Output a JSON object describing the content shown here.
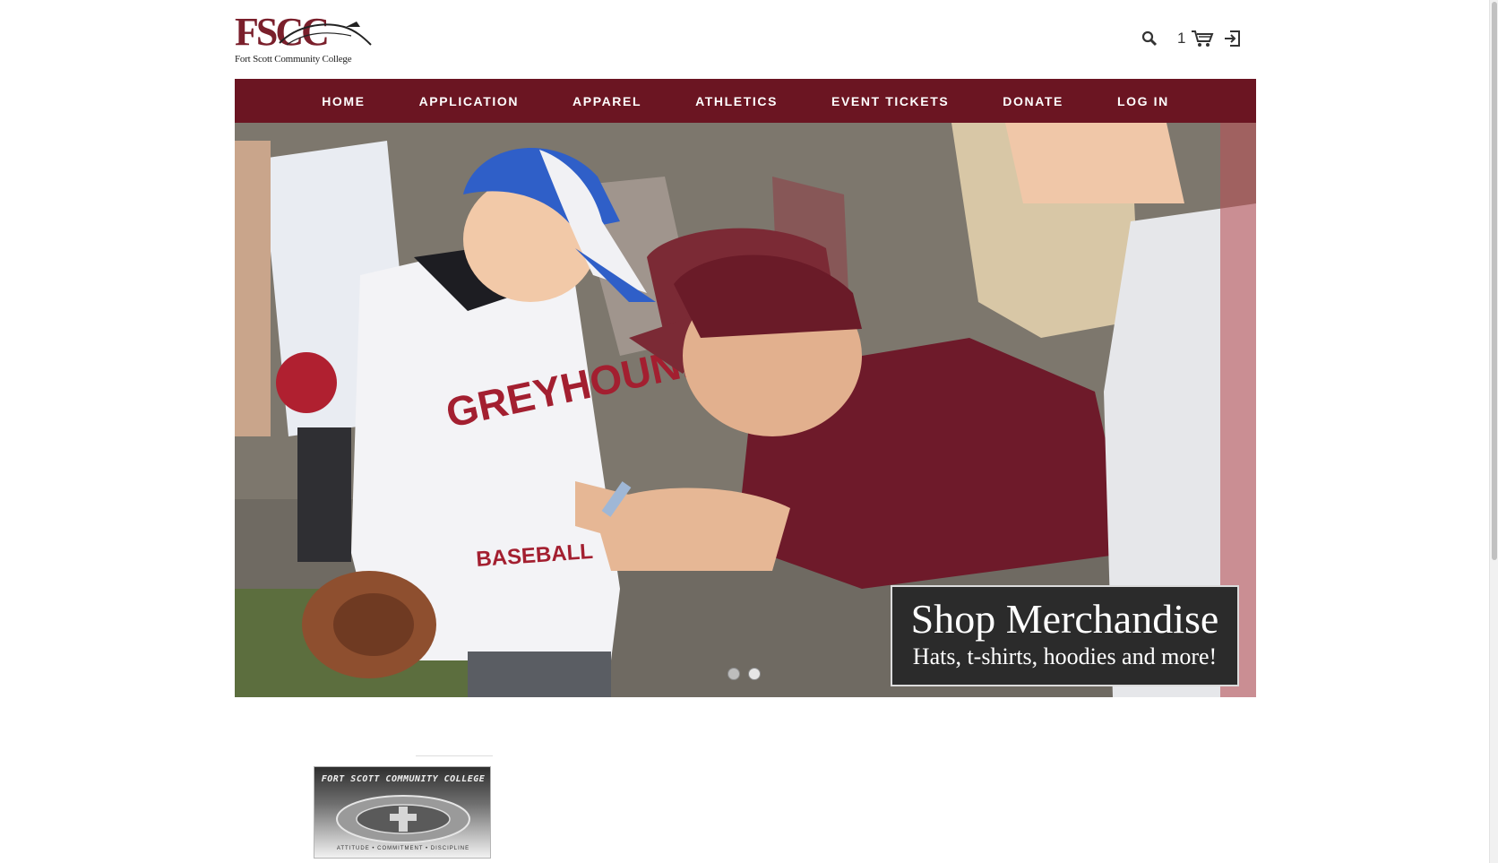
{
  "site": {
    "logo_mark": "FSCC",
    "logo_name": "Fort Scott Community College"
  },
  "header": {
    "cart_count": "1",
    "icons": [
      "search-icon",
      "cart-icon",
      "login-icon"
    ]
  },
  "nav": {
    "items": [
      {
        "label": "HOME"
      },
      {
        "label": "APPLICATION"
      },
      {
        "label": "APPAREL"
      },
      {
        "label": "ATHLETICS"
      },
      {
        "label": "EVENT TICKETS"
      },
      {
        "label": "DONATE"
      },
      {
        "label": "LOG IN"
      }
    ]
  },
  "hero": {
    "title": "Shop Merchandise",
    "subtitle": "Hats, t-shirts, hoodies and more!",
    "slide_count": 2,
    "active_slide": 2,
    "shirt_text_1": "GREYHOUNDS",
    "shirt_text_2": "BASEBALL"
  },
  "product": {
    "image_title": "FORT SCOTT COMMUNITY COLLEGE",
    "image_motto": "ATTITUDE • COMMITMENT • DISCIPLINE"
  },
  "colors": {
    "brand": "#6b1522",
    "logo": "#7a1f2b",
    "promo_bg": "#2b2b2b"
  }
}
